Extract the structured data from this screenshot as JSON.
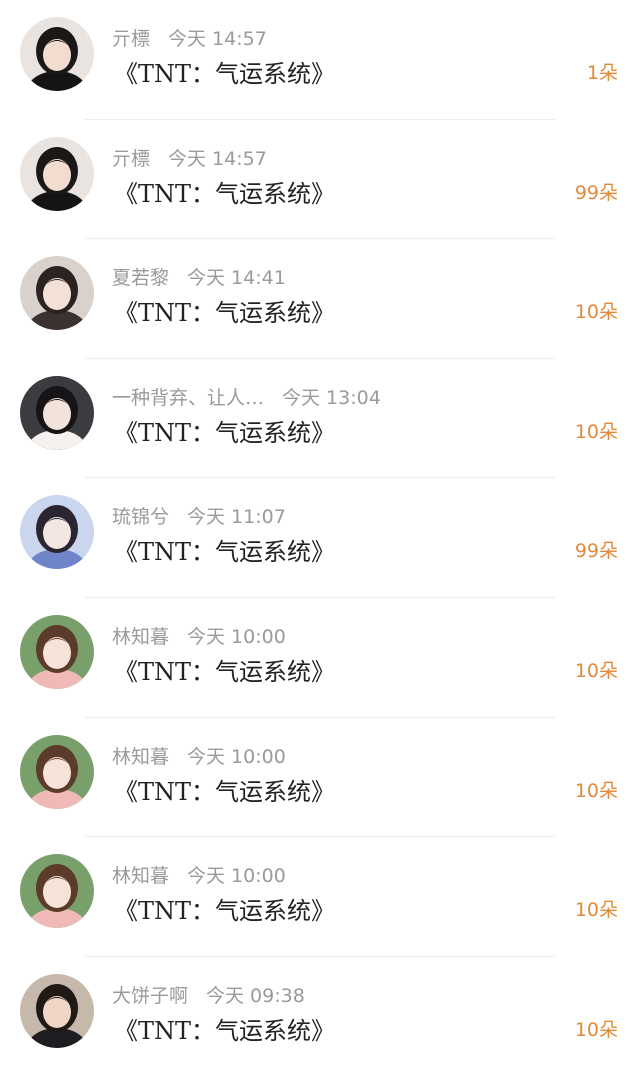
{
  "colors": {
    "gift_count": "#e28a3b",
    "meta_text": "#9a9a9a",
    "title_text": "#222222",
    "divider": "#eeeeee"
  },
  "items": [
    {
      "name": "亓標",
      "time": "今天 14:57",
      "title": "《TNT：气运系统》",
      "gift": "1朵",
      "avatar": {
        "bg": "#e9e4df",
        "hair": "#1b1818",
        "face": "#f2dcd0",
        "cloth": "#151414"
      }
    },
    {
      "name": "亓標",
      "time": "今天 14:57",
      "title": "《TNT：气运系统》",
      "gift": "99朵",
      "avatar": {
        "bg": "#e9e4df",
        "hair": "#1b1818",
        "face": "#f2dcd0",
        "cloth": "#151414"
      }
    },
    {
      "name": "夏若黎",
      "time": "今天 14:41",
      "title": "《TNT：气运系统》",
      "gift": "10朵",
      "avatar": {
        "bg": "#d9d2cc",
        "hair": "#2a2321",
        "face": "#f3e1d8",
        "cloth": "#3b3131"
      }
    },
    {
      "name": "一种背弃、让人…",
      "time": "今天 13:04",
      "title": "《TNT：气运系统》",
      "gift": "10朵",
      "avatar": {
        "bg": "#3c3b40",
        "hair": "#161416",
        "face": "#f1e2dc",
        "cloth": "#f4f1ef"
      }
    },
    {
      "name": "琉锦兮",
      "time": "今天 11:07",
      "title": "《TNT：气运系统》",
      "gift": "99朵",
      "avatar": {
        "bg": "#c9d6ee",
        "hair": "#2a2530",
        "face": "#f4e6e0",
        "cloth": "#6f84c9"
      }
    },
    {
      "name": "林知暮",
      "time": "今天 10:00",
      "title": "《TNT：气运系统》",
      "gift": "10朵",
      "avatar": {
        "bg": "#79a06a",
        "hair": "#5b3b2a",
        "face": "#f6e2d6",
        "cloth": "#f0b9b8"
      }
    },
    {
      "name": "林知暮",
      "time": "今天 10:00",
      "title": "《TNT：气运系统》",
      "gift": "10朵",
      "avatar": {
        "bg": "#79a06a",
        "hair": "#5b3b2a",
        "face": "#f6e2d6",
        "cloth": "#f0b9b8"
      }
    },
    {
      "name": "林知暮",
      "time": "今天 10:00",
      "title": "《TNT：气运系统》",
      "gift": "10朵",
      "avatar": {
        "bg": "#79a06a",
        "hair": "#5b3b2a",
        "face": "#f6e2d6",
        "cloth": "#f0b9b8"
      }
    },
    {
      "name": "大饼子啊",
      "time": "今天 09:38",
      "title": "《TNT：气运系统》",
      "gift": "10朵",
      "avatar": {
        "bg": "#c7b8ac",
        "hair": "#201a17",
        "face": "#efd6c7",
        "cloth": "#1e1e22"
      }
    }
  ]
}
